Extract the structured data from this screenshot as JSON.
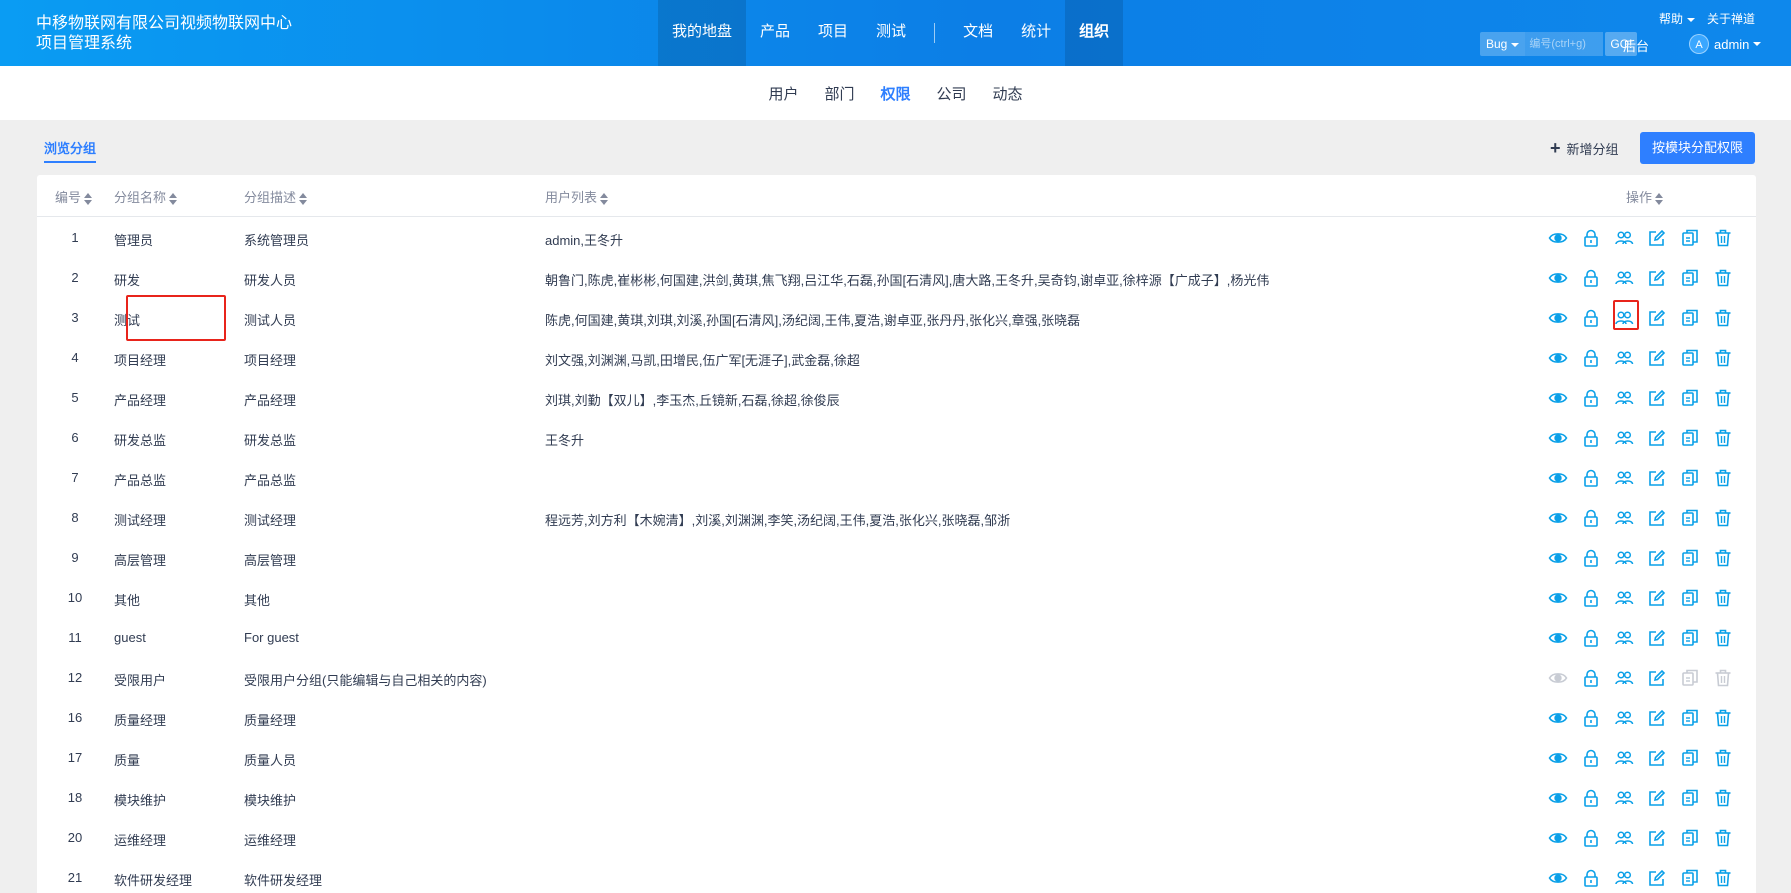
{
  "header": {
    "company": "中移物联网有限公司视频物联网中心项目管理系统",
    "nav": [
      {
        "label": "我的地盘",
        "active": true
      },
      {
        "label": "产品"
      },
      {
        "label": "项目"
      },
      {
        "label": "测试"
      },
      {
        "label": "文档"
      },
      {
        "label": "统计"
      },
      {
        "label": "组织",
        "bold": true
      }
    ],
    "help": "帮助",
    "about": "关于禅道",
    "search_type": "Bug",
    "search_placeholder": "编号(ctrl+g)",
    "go": "GO!",
    "backend": "后台",
    "avatar_letter": "A",
    "user": "admin"
  },
  "subnav": [
    "用户",
    "部门",
    "权限",
    "公司",
    "动态"
  ],
  "subnav_active": "权限",
  "toolbar": {
    "browse": "浏览分组",
    "add_group": "新增分组",
    "assign": "按模块分配权限"
  },
  "table": {
    "headers": {
      "id": "编号",
      "name": "分组名称",
      "desc": "分组描述",
      "users": "用户列表",
      "actions": "操作"
    },
    "rows": [
      {
        "id": "1",
        "name": "管理员",
        "desc": "系统管理员",
        "users": "admin,王冬升"
      },
      {
        "id": "2",
        "name": "研发",
        "desc": "研发人员",
        "users": "朝鲁门,陈虎,崔彬彬,何国建,洪剑,黄琪,焦飞翔,吕江华,石磊,孙国[石清风],唐大路,王冬升,吴奇钧,谢卓亚,徐梓源【广成子】,杨光伟"
      },
      {
        "id": "3",
        "name": "测试",
        "desc": "测试人员",
        "users": "陈虎,何国建,黄琪,刘琪,刘溪,孙国[石清风],汤纪阔,王伟,夏浩,谢卓亚,张丹丹,张化兴,章强,张晓磊"
      },
      {
        "id": "4",
        "name": "项目经理",
        "desc": "项目经理",
        "users": "刘文强,刘渊渊,马凯,田增民,伍广军[无涯子],武金磊,徐超"
      },
      {
        "id": "5",
        "name": "产品经理",
        "desc": "产品经理",
        "users": "刘琪,刘勤【双儿】,李玉杰,丘镜新,石磊,徐超,徐俊辰"
      },
      {
        "id": "6",
        "name": "研发总监",
        "desc": "研发总监",
        "users": "王冬升"
      },
      {
        "id": "7",
        "name": "产品总监",
        "desc": "产品总监",
        "users": ""
      },
      {
        "id": "8",
        "name": "测试经理",
        "desc": "测试经理",
        "users": "程远芳,刘方利【木婉清】,刘溪,刘渊渊,李笑,汤纪阔,王伟,夏浩,张化兴,张晓磊,邹浙"
      },
      {
        "id": "9",
        "name": "高层管理",
        "desc": "高层管理",
        "users": ""
      },
      {
        "id": "10",
        "name": "其他",
        "desc": "其他",
        "users": ""
      },
      {
        "id": "11",
        "name": "guest",
        "desc": "For guest",
        "users": ""
      },
      {
        "id": "12",
        "name": "受限用户",
        "desc": "受限用户分组(只能编辑与自己相关的内容)",
        "users": "",
        "limited": true
      },
      {
        "id": "16",
        "name": "质量经理",
        "desc": "质量经理",
        "users": ""
      },
      {
        "id": "17",
        "name": "质量",
        "desc": "质量人员",
        "users": ""
      },
      {
        "id": "18",
        "name": "模块维护",
        "desc": "模块维护",
        "users": ""
      },
      {
        "id": "20",
        "name": "运维经理",
        "desc": "运维经理",
        "users": ""
      },
      {
        "id": "21",
        "name": "软件研发经理",
        "desc": "软件研发经理",
        "users": ""
      }
    ]
  },
  "colors": {
    "primary": "#2e7fff",
    "icon": "#0aa0e8",
    "highlight": "#e8241b"
  },
  "action_icons": [
    "eye-icon",
    "lock-icon",
    "users-icon",
    "edit-icon",
    "copy-icon",
    "trash-icon"
  ]
}
